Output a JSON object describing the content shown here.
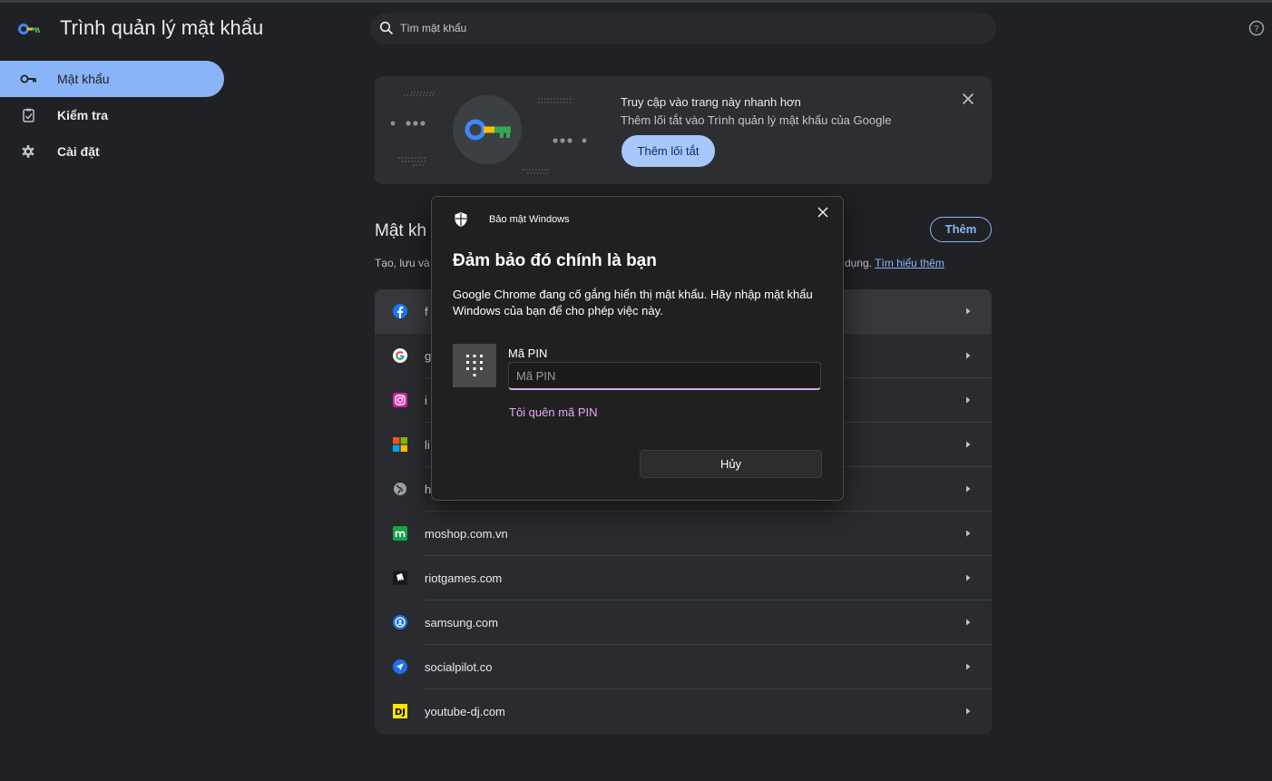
{
  "header": {
    "app_title": "Trình quản lý mật khẩu",
    "search_placeholder": "Tìm mật khẩu"
  },
  "sidebar": {
    "items": [
      {
        "label": "Mật khẩu",
        "icon": "key-icon",
        "active": true
      },
      {
        "label": "Kiểm tra",
        "icon": "checkup-icon",
        "active": false
      },
      {
        "label": "Cài đặt",
        "icon": "gear-icon",
        "active": false
      }
    ]
  },
  "banner": {
    "title": "Truy cập vào trang này nhanh hơn",
    "subtitle": "Thêm lối tắt vào Trình quản lý mật khẩu của Google",
    "button": "Thêm lối tắt"
  },
  "section": {
    "title_visible": "Mật kh",
    "desc_start": "Tạo, lưu và",
    "desc_end": "dụng.",
    "learn_more": "Tìm hiểu thêm",
    "add_button": "Thêm"
  },
  "passwords": [
    {
      "site": "f",
      "icon": "facebook-icon",
      "hidden": true
    },
    {
      "site": "g",
      "icon": "google-icon",
      "hidden": true
    },
    {
      "site": "i",
      "icon": "instagram-icon",
      "hidden": true
    },
    {
      "site": "li",
      "icon": "microsoft-icon",
      "hidden": true
    },
    {
      "site": "h",
      "icon": "globe-icon",
      "hidden": true
    },
    {
      "site": "moshop.com.vn",
      "icon": "moshop-icon"
    },
    {
      "site": "riotgames.com",
      "icon": "riot-icon"
    },
    {
      "site": "samsung.com",
      "icon": "samsung-icon"
    },
    {
      "site": "socialpilot.co",
      "icon": "socialpilot-icon"
    },
    {
      "site": "youtube-dj.com",
      "icon": "dj-icon"
    }
  ],
  "dialog": {
    "app_name": "Bảo mật Windows",
    "title": "Đảm bảo đó chính là bạn",
    "body": "Google Chrome đang cố gắng hiển thị mật khẩu. Hãy nhập mật khẩu Windows của bạn để cho phép việc này.",
    "pin_label": "Mã PIN",
    "pin_placeholder": "Mã PIN",
    "forgot_pin": "Tôi quên mã PIN",
    "cancel": "Hủy"
  },
  "colors": {
    "accent": "#8ab4f8",
    "background": "#202124",
    "dialog_bg": "#202020",
    "pin_accent": "#d6a9f3"
  }
}
